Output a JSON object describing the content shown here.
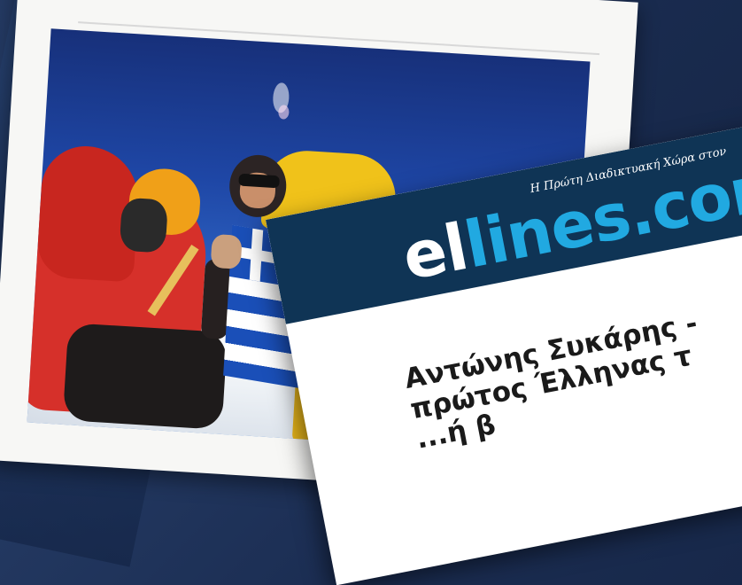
{
  "news_card": {
    "tagline": "Η Πρώτη Διαδικτυακή Χώρα στον",
    "logo_part1": "el",
    "logo_part2": "lines.com",
    "headline_lines": [
      "Αντώνης Συκάρης -",
      "πρώτος Έλληνας τ",
      "...ή β"
    ]
  },
  "photo": {
    "description_colors": {
      "sky": "#1e46a5",
      "suit_red": "#d6302a",
      "jacket_yellow": "#f0c21a",
      "flag_blue": "#1a4fb8"
    }
  },
  "colors": {
    "background": "#1b2d52",
    "header_navy": "#0f3455",
    "brand_blue": "#21a9e1"
  }
}
